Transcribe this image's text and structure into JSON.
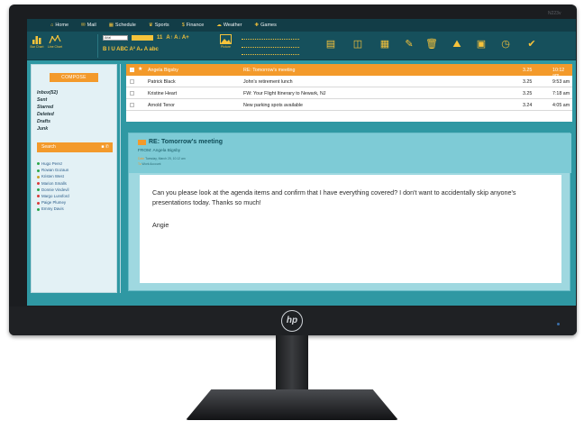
{
  "monitor": {
    "logo": "hp",
    "model": "N223v"
  },
  "nav": {
    "items": [
      {
        "icon": "home-icon",
        "glyph": "⌂",
        "label": "Home"
      },
      {
        "icon": "mail-icon",
        "glyph": "✉",
        "label": "Mail"
      },
      {
        "icon": "calendar-icon",
        "glyph": "▦",
        "label": "Schedule"
      },
      {
        "icon": "trophy-icon",
        "glyph": "♛",
        "label": "Sports"
      },
      {
        "icon": "dollar-icon",
        "glyph": "$",
        "label": "Finance"
      },
      {
        "icon": "cloud-icon",
        "glyph": "☁",
        "label": "Weather"
      },
      {
        "icon": "gamepad-icon",
        "glyph": "✚",
        "label": "Games"
      }
    ]
  },
  "ribbon": {
    "bar_chart_label": "Bar Chart",
    "line_chart_label": "Line Chart",
    "font_name": "Arial",
    "font_size": "11",
    "format_row_1": "A↑  A↓  A+",
    "format_row_2": "B  I  U  ABC  A²  A₂  A  abc",
    "picture_label": "Picture",
    "tools": [
      {
        "icon": "clipboard-icon",
        "glyph": "▤"
      },
      {
        "icon": "book-icon",
        "glyph": "◫"
      },
      {
        "icon": "calendar-grid-icon",
        "glyph": "▦"
      },
      {
        "icon": "pencil-icon",
        "glyph": "✎"
      },
      {
        "icon": "trash-icon",
        "glyph": "🗑"
      },
      {
        "icon": "mountain-image-icon",
        "glyph": "⛰"
      },
      {
        "icon": "briefcase-icon",
        "glyph": "▣"
      },
      {
        "icon": "clock-icon",
        "glyph": "◷"
      },
      {
        "icon": "checkmark-circle-icon",
        "glyph": "✔"
      }
    ]
  },
  "sidebar": {
    "compose_label": "COMPOSE",
    "folders": [
      "Inbox(52)",
      "Sent",
      "Starred",
      "Deleted",
      "Drafts",
      "Junk"
    ],
    "search_label": "Search",
    "contacts": [
      {
        "name": "Hugo Perez",
        "color": "#2aa84a"
      },
      {
        "name": "Rowan Gozaun",
        "color": "#2aa84a"
      },
      {
        "name": "Kristen West",
        "color": "#c9a227"
      },
      {
        "name": "Marion Smalls",
        "color": "#d93a3a"
      },
      {
        "name": "Donnie Vindevil",
        "color": "#2aa84a"
      },
      {
        "name": "Margo Lunsford",
        "color": "#d93a3a"
      },
      {
        "name": "Paige Plumey",
        "color": "#d93a3a"
      },
      {
        "name": "Emmy Davis",
        "color": "#2aa84a"
      }
    ]
  },
  "messages": [
    {
      "from": "Angela Bigsby",
      "subject": "RE: Tomorrow's meeting",
      "size": "3.25",
      "time": "10:12 am",
      "selected": true
    },
    {
      "from": "Patrick Black",
      "subject": "John's retirement lunch",
      "size": "3.25",
      "time": "9:53 am",
      "selected": false
    },
    {
      "from": "Kristine Heart",
      "subject": "FW: Your Flight Itinerary to Newark, NJ",
      "size": "3.25",
      "time": "7:18 am",
      "selected": false
    },
    {
      "from": "Arnold Tenor",
      "subject": "New parking spots available",
      "size": "3.24",
      "time": "4:05 am",
      "selected": false
    }
  ],
  "reading": {
    "subject": "RE: Tomorrow's meeting",
    "from": "FROM: Angela Bigsby",
    "date_label": "Date",
    "date": "Tuesday, March 25, 10:12 am",
    "to_label": "To",
    "to": "Work Account",
    "body": "Can you please look at the agenda items and confirm that I have everything covered? I don't want to accidentally skip anyone's presentations today. Thanks so much!",
    "signature": "Angie"
  },
  "colors": {
    "accent": "#f39a2b",
    "screen_bg": "#2f98a3",
    "nav_bg": "#123d47",
    "ribbon_bg": "#16505c",
    "icon_yellow": "#f6c33b"
  }
}
